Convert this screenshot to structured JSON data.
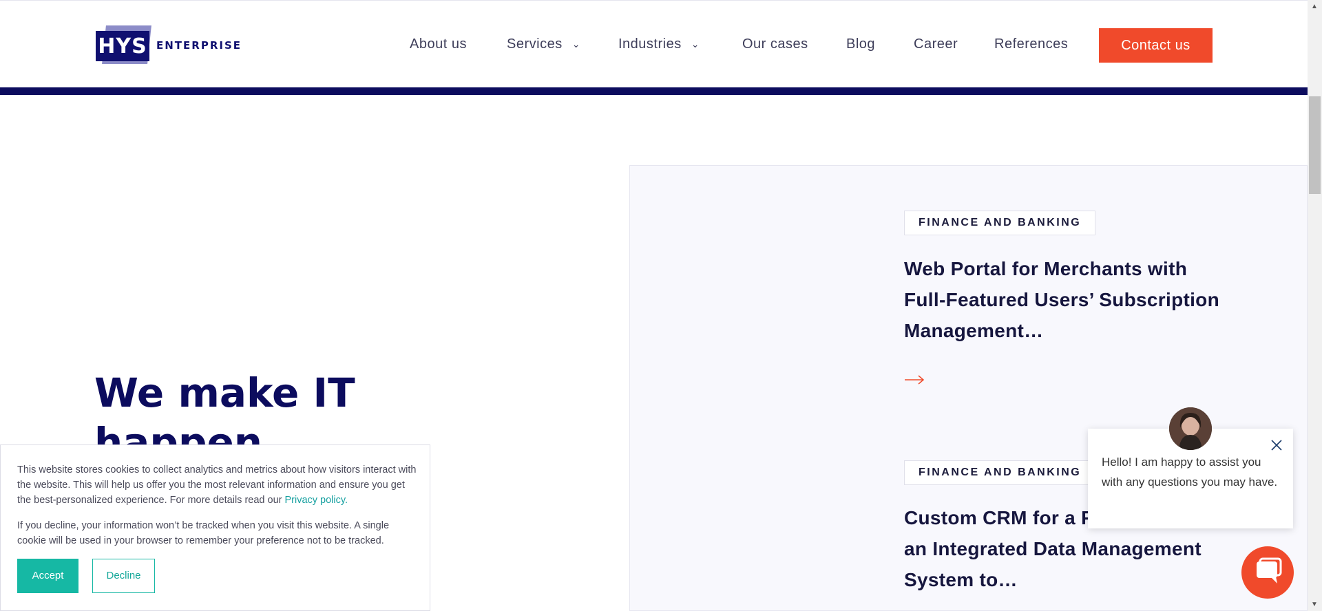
{
  "header": {
    "logo": {
      "mark": "HYS",
      "text": "ENTERPRISE"
    },
    "nav": [
      {
        "label": "About us"
      },
      {
        "label": "Services"
      },
      {
        "label": "Industries"
      },
      {
        "label": "Our cases"
      },
      {
        "label": "Blog"
      },
      {
        "label": "Career"
      },
      {
        "label": "References"
      }
    ],
    "contact_label": "Contact us"
  },
  "hero": {
    "line1": "We make IT",
    "line2": "happen"
  },
  "cases": [
    {
      "tag": "FINANCE AND BANKING",
      "title": "Web Portal for Merchants with Full-Featured Users’ Subscription Management…"
    },
    {
      "tag": "FINANCE AND BANKING",
      "title": "Custom CRM for a Platform with an Integrated Data Management System to…"
    }
  ],
  "cookie": {
    "text1": "This website stores cookies to collect analytics and metrics about how visitors interact with the website. This will help us offer you the most relevant information and ensure you get the best-personalized experience. For more details read our ",
    "privacy_link": "Privacy policy",
    "text1_end": ".",
    "text2": "If you decline, your information won’t be tracked when you visit this website. A single cookie will be used in your browser to remember your preference not to be tracked.",
    "accept_label": "Accept",
    "decline_label": "Decline"
  },
  "chat": {
    "message": "Hello! I am happy to assist you with any questions you may have."
  },
  "colors": {
    "brand_navy": "#0c0c5e",
    "accent_orange": "#f04a2b",
    "accept_teal": "#16b8a4"
  },
  "icons": [
    "chevron-down-icon",
    "arrow-right-icon",
    "close-icon",
    "chat-icon",
    "avatar"
  ]
}
